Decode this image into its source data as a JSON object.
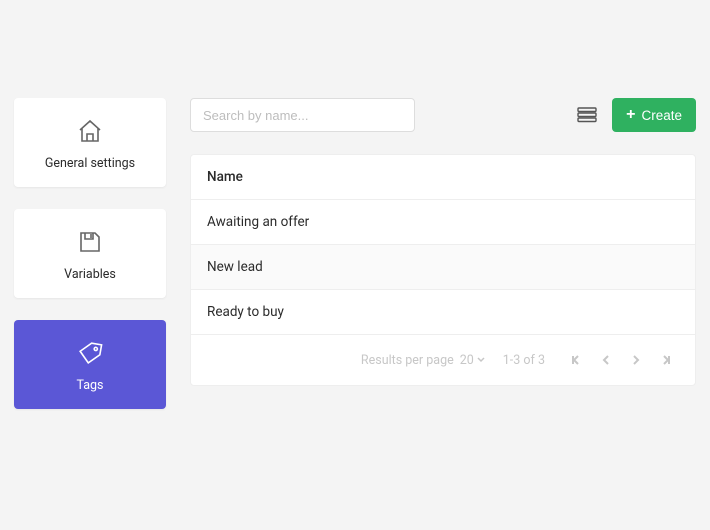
{
  "sidebar": {
    "items": [
      {
        "label": "General settings"
      },
      {
        "label": "Variables"
      },
      {
        "label": "Tags"
      }
    ]
  },
  "search": {
    "placeholder": "Search by name..."
  },
  "toolbar": {
    "create_label": "Create"
  },
  "table": {
    "header": "Name",
    "rows": [
      {
        "name": "Awaiting an offer"
      },
      {
        "name": "New lead"
      },
      {
        "name": "Ready to buy"
      }
    ],
    "footer": {
      "results_per_page_label": "Results per page",
      "results_per_page_value": "20",
      "range": "1-3 of 3"
    }
  }
}
